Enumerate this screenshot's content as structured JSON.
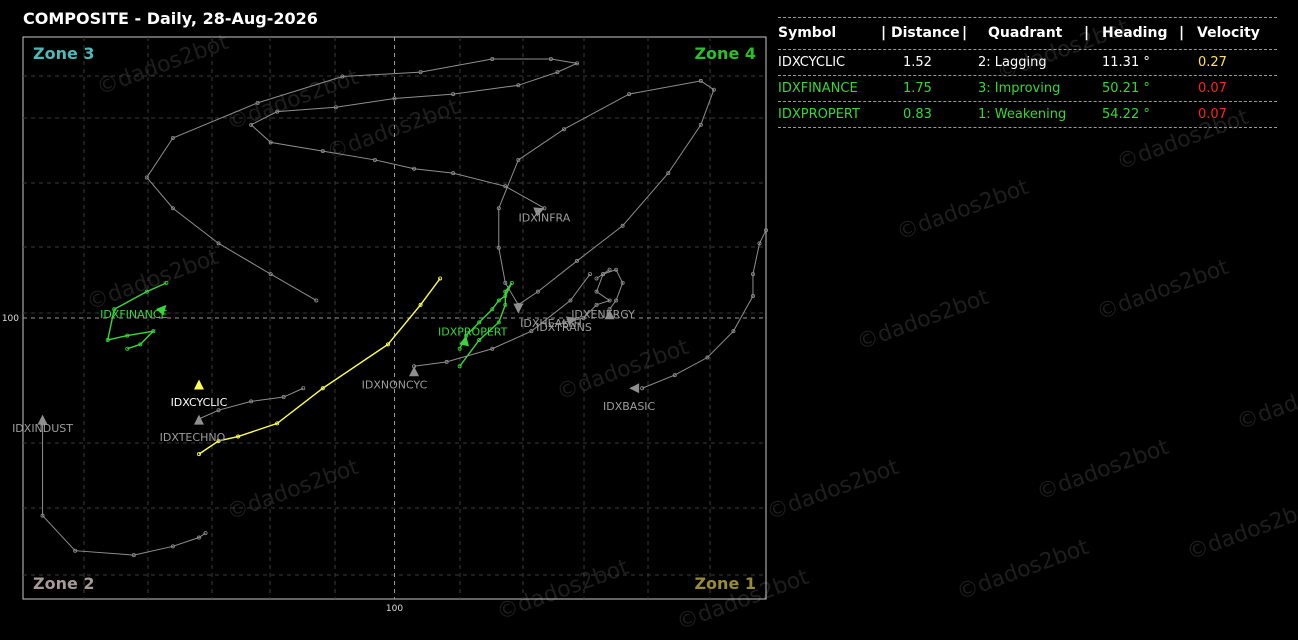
{
  "title": "COMPOSITE - Daily, 28-Aug-2026",
  "watermark": "©dados2bot",
  "colors": {
    "background": "#000000",
    "gridline": "#8a8a8a",
    "trail_gray": "#8f8f8f",
    "label_gray": "#9d9d9d",
    "cyclic": "#ffff55",
    "green": "#3ad53a",
    "zone3": "#4fb8b8",
    "zone4": "#2bbf2b",
    "zone2": "#a89999",
    "zone1": "#9a8b35",
    "velocity_yellow": "#ffe066",
    "velocity_red": "#ff2020"
  },
  "chart_data": {
    "type": "scatter",
    "title": "COMPOSITE - Daily, 28-Aug-2026",
    "center": {
      "x": 100,
      "y": 100
    },
    "x_tick_label": "100",
    "y_tick_label": "100",
    "grid": "dashed",
    "xlim": [
      94.3,
      105.7
    ],
    "ylim": [
      93.6,
      106.4
    ],
    "zones": [
      {
        "name": "Zone 3",
        "position": "top-left"
      },
      {
        "name": "Zone 4",
        "position": "top-right"
      },
      {
        "name": "Zone 2",
        "position": "bottom-left"
      },
      {
        "name": "Zone 1",
        "position": "bottom-right"
      }
    ],
    "series": [
      {
        "name": "IDXCYCLIC",
        "color": "#ffff55",
        "label_color": "#ffffff",
        "x": [
          97.0,
          97.3,
          97.6,
          98.2,
          98.9,
          99.9,
          100.4,
          100.7
        ],
        "y": [
          96.9,
          97.2,
          97.3,
          97.6,
          98.4,
          99.4,
          100.3,
          100.9
        ],
        "arrow": [
          97.0,
          98.6
        ],
        "label": [
          97.0,
          98.0
        ]
      },
      {
        "name": "IDXFINANCE",
        "color": "#3ad53a",
        "label_color": "#3ad53a",
        "x": [
          95.9,
          96.1,
          96.3,
          95.9,
          95.6,
          95.7,
          96.2,
          96.5
        ],
        "y": [
          99.3,
          99.4,
          99.7,
          99.6,
          99.5,
          100.2,
          100.6,
          100.8
        ],
        "arrow": [
          96.5,
          100.3
        ],
        "label": [
          96.0,
          100.0
        ]
      },
      {
        "name": "IDXPROPERT",
        "color": "#3ad53a",
        "label_color": "#3ad53a",
        "x": [
          101.0,
          101.3,
          101.6,
          101.7,
          101.7,
          101.8,
          101.7,
          101.6,
          101.5,
          101.3,
          101.1,
          101.0
        ],
        "y": [
          98.9,
          99.5,
          99.9,
          100.3,
          100.6,
          100.8,
          100.5,
          100.4,
          100.2,
          99.9,
          99.6,
          99.3
        ],
        "arrow": [
          101.1,
          99.6
        ],
        "label": [
          101.2,
          99.6
        ]
      },
      {
        "name": "IDXINFRA",
        "color": "#8f8f8f",
        "label_color": "#9d9d9d",
        "x": [
          98.8,
          98.1,
          97.3,
          96.6,
          96.2,
          96.6,
          97.9,
          99.2,
          100.4,
          101.5,
          102.4,
          102.8,
          102.5,
          101.9,
          100.9,
          100.0,
          99.1,
          98.2,
          97.8,
          98.1,
          98.9,
          99.7,
          100.3,
          100.9,
          101.7,
          102.3
        ],
        "y": [
          100.4,
          101.0,
          101.7,
          102.5,
          103.2,
          104.1,
          104.9,
          105.5,
          105.6,
          105.9,
          105.9,
          105.8,
          105.6,
          105.3,
          105.1,
          105.0,
          104.8,
          104.7,
          104.4,
          104.0,
          103.8,
          103.6,
          103.4,
          103.3,
          103.0,
          102.5
        ],
        "arrow": [
          102.3,
          102.5
        ],
        "label": [
          102.3,
          102.2
        ]
      },
      {
        "name": "IDXHEALTH",
        "color": "#8f8f8f",
        "label_color": "#9d9d9d",
        "x": [
          101.9,
          102.2,
          102.8,
          103.5,
          104.2,
          104.7,
          104.9,
          104.7,
          103.6,
          102.6,
          101.9,
          101.6,
          101.6,
          101.7,
          101.9
        ],
        "y": [
          100.3,
          100.6,
          101.3,
          102.1,
          103.3,
          104.4,
          105.2,
          105.4,
          105.1,
          104.3,
          103.6,
          102.5,
          101.6,
          100.8,
          100.3
        ],
        "arrow": [
          101.9,
          100.1
        ],
        "label": [
          102.4,
          99.8
        ]
      },
      {
        "name": "IDXENERGY",
        "color": "#8f8f8f",
        "label_color": "#9d9d9d",
        "x": [
          102.6,
          102.9,
          103.1,
          103.3,
          103.1,
          103.2,
          103.3
        ],
        "y": [
          99.9,
          100.0,
          100.3,
          100.4,
          100.6,
          101.0,
          101.1
        ],
        "arrow": [
          102.8,
          100.0
        ],
        "label": [
          103.2,
          100.0
        ]
      },
      {
        "name": "IDXTRANS",
        "color": "#8f8f8f",
        "label_color": "#9d9d9d",
        "x": [
          103.3,
          103.4,
          103.5,
          103.4,
          103.2,
          103.1
        ],
        "y": [
          100.2,
          100.4,
          100.8,
          101.1,
          101.0,
          100.9
        ],
        "arrow": [
          103.3,
          100.2
        ],
        "label": [
          102.6,
          99.7
        ]
      },
      {
        "name": "IDXBASIC",
        "color": "#8f8f8f",
        "label_color": "#9d9d9d",
        "x": [
          103.8,
          104.3,
          104.8,
          105.2,
          105.5,
          105.5,
          105.6,
          105.7
        ],
        "y": [
          98.4,
          98.7,
          99.1,
          99.7,
          100.5,
          101.0,
          101.7,
          102.0
        ],
        "arrow": [
          103.6,
          98.4
        ],
        "label": [
          103.6,
          97.9
        ]
      },
      {
        "name": "IDXNONCYC",
        "color": "#8f8f8f",
        "label_color": "#9d9d9d",
        "x": [
          100.3,
          100.8,
          101.5,
          102.1,
          102.7,
          103.0
        ],
        "y": [
          98.9,
          99.0,
          99.3,
          99.7,
          100.4,
          101.0
        ],
        "arrow": [
          100.3,
          98.9
        ],
        "label": [
          100.0,
          98.4
        ]
      },
      {
        "name": "IDXTECHNO",
        "color": "#8f8f8f",
        "label_color": "#9d9d9d",
        "x": [
          97.0,
          97.3,
          97.8,
          98.3,
          98.6
        ],
        "y": [
          97.7,
          97.9,
          98.1,
          98.2,
          98.4
        ],
        "arrow": [
          97.0,
          97.8
        ],
        "label": [
          96.9,
          97.2
        ]
      },
      {
        "name": "IDXINDUST",
        "color": "#8f8f8f",
        "label_color": "#9d9d9d",
        "x": [
          94.6,
          94.6,
          95.1,
          96.0,
          96.6,
          97.0,
          97.1
        ],
        "y": [
          97.6,
          95.5,
          94.7,
          94.6,
          94.8,
          95.0,
          95.1
        ],
        "arrow": [
          94.6,
          97.8
        ],
        "label": [
          94.6,
          97.4
        ]
      }
    ]
  },
  "table": {
    "columns": [
      "Symbol",
      "Distance",
      "Quadrant",
      "Heading",
      "Velocity"
    ],
    "rows": [
      {
        "symbol": "IDXCYCLIC",
        "distance": "1.52",
        "quadrant": "2: Lagging",
        "heading": "11.31 °",
        "velocity": "0.27",
        "text_color": "#ffffff",
        "velocity_color": "#ffe066"
      },
      {
        "symbol": "IDXFINANCE",
        "distance": "1.75",
        "quadrant": "3: Improving",
        "heading": "50.21 °",
        "velocity": "0.07",
        "text_color": "#3ad53a",
        "velocity_color": "#ff2020"
      },
      {
        "symbol": "IDXPROPERT",
        "distance": "0.83",
        "quadrant": "1: Weakening",
        "heading": "54.22 °",
        "velocity": "0.07",
        "text_color": "#3ad53a",
        "velocity_color": "#ff2020"
      }
    ]
  }
}
